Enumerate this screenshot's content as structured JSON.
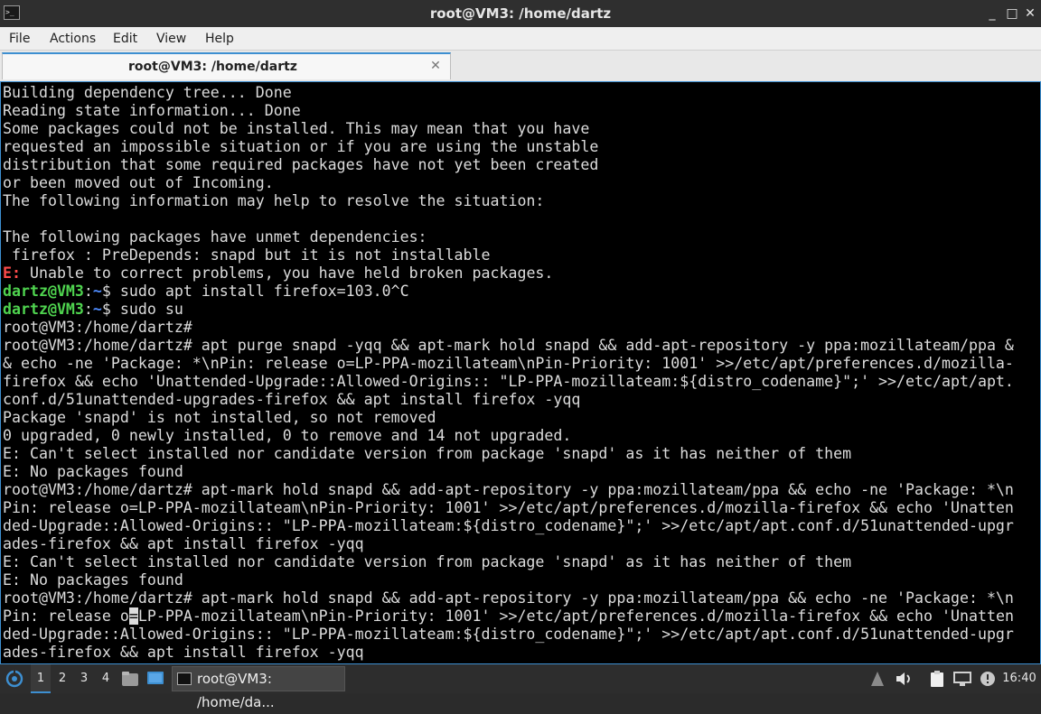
{
  "window": {
    "title": "root@VM3: /home/dartz",
    "icons": {
      "app": "terminal-icon",
      "minimize": "minimize-icon",
      "maximize": "maximize-icon",
      "close": "close-icon"
    },
    "glyphs": {
      "app": ">_",
      "minimize": "_",
      "maximize": "□",
      "close": "✕"
    }
  },
  "menu": {
    "file": "File",
    "actions": "Actions",
    "edit": "Edit",
    "view": "View",
    "help": "Help"
  },
  "tab": {
    "label": "root@VM3: /home/dartz",
    "close_glyph": "✕"
  },
  "terminal": {
    "lines": [
      [
        {
          "t": "Building dependency tree... Done"
        }
      ],
      [
        {
          "t": "Reading state information... Done"
        }
      ],
      [
        {
          "t": "Some packages could not be installed. This may mean that you have"
        }
      ],
      [
        {
          "t": "requested an impossible situation or if you are using the unstable"
        }
      ],
      [
        {
          "t": "distribution that some required packages have not yet been created"
        }
      ],
      [
        {
          "t": "or been moved out of Incoming."
        }
      ],
      [
        {
          "t": "The following information may help to resolve the situation:"
        }
      ],
      [
        {
          "t": ""
        }
      ],
      [
        {
          "t": "The following packages have unmet dependencies:"
        }
      ],
      [
        {
          "t": " firefox : PreDepends: snapd but it is not installable"
        }
      ],
      [
        {
          "t": "E:",
          "c": "red"
        },
        {
          "t": " Unable to correct problems, you have held broken packages."
        }
      ],
      [
        {
          "t": "dartz@VM3",
          "c": "green"
        },
        {
          "t": ":"
        },
        {
          "t": "~",
          "c": "blue"
        },
        {
          "t": "$ sudo apt install firefox=103.0^C"
        }
      ],
      [
        {
          "t": "dartz@VM3",
          "c": "green"
        },
        {
          "t": ":"
        },
        {
          "t": "~",
          "c": "blue"
        },
        {
          "t": "$ sudo su"
        }
      ],
      [
        {
          "t": "root@VM3:/home/dartz#"
        }
      ],
      [
        {
          "t": "root@VM3:/home/dartz# apt purge snapd -yqq && apt-mark hold snapd && add-apt-repository -y ppa:mozillateam/ppa &"
        }
      ],
      [
        {
          "t": "& echo -ne 'Package: *\\nPin: release o=LP-PPA-mozillateam\\nPin-Priority: 1001' >>/etc/apt/preferences.d/mozilla-"
        }
      ],
      [
        {
          "t": "firefox && echo 'Unattended-Upgrade::Allowed-Origins:: \"LP-PPA-mozillateam:${distro_codename}\";' >>/etc/apt/apt."
        }
      ],
      [
        {
          "t": "conf.d/51unattended-upgrades-firefox && apt install firefox -yqq"
        }
      ],
      [
        {
          "t": "Package 'snapd' is not installed, so not removed"
        }
      ],
      [
        {
          "t": "0 upgraded, 0 newly installed, 0 to remove and 14 not upgraded."
        }
      ],
      [
        {
          "t": "E: Can't select installed nor candidate version from package 'snapd' as it has neither of them"
        }
      ],
      [
        {
          "t": "E: No packages found"
        }
      ],
      [
        {
          "t": "root@VM3:/home/dartz# apt-mark hold snapd && add-apt-repository -y ppa:mozillateam/ppa && echo -ne 'Package: *\\n"
        }
      ],
      [
        {
          "t": "Pin: release o=LP-PPA-mozillateam\\nPin-Priority: 1001' >>/etc/apt/preferences.d/mozilla-firefox && echo 'Unatten"
        }
      ],
      [
        {
          "t": "ded-Upgrade::Allowed-Origins:: \"LP-PPA-mozillateam:${distro_codename}\";' >>/etc/apt/apt.conf.d/51unattended-upgr"
        }
      ],
      [
        {
          "t": "ades-firefox && apt install firefox -yqq"
        }
      ],
      [
        {
          "t": "E: Can't select installed nor candidate version from package 'snapd' as it has neither of them"
        }
      ],
      [
        {
          "t": "E: No packages found"
        }
      ],
      [
        {
          "t": "root@VM3:/home/dartz# apt-mark hold snapd && add-apt-repository -y ppa:mozillateam/ppa && echo -ne 'Package: *\\n"
        }
      ],
      [
        {
          "t": "Pin: release o"
        },
        {
          "t": "=",
          "c": "cursor"
        },
        {
          "t": "LP-PPA-mozillateam\\nPin-Priority: 1001' >>/etc/apt/preferences.d/mozilla-firefox && echo 'Unatten"
        }
      ],
      [
        {
          "t": "ded-Upgrade::Allowed-Origins:: \"LP-PPA-mozillateam:${distro_codename}\";' >>/etc/apt/apt.conf.d/51unattended-upgr"
        }
      ],
      [
        {
          "t": "ades-firefox && apt install firefox -yqq"
        }
      ]
    ]
  },
  "taskbar": {
    "start_icon": "start-menu-icon",
    "workspaces": [
      "1",
      "2",
      "3",
      "4"
    ],
    "active_workspace": "1",
    "launchers": [
      "file-manager-icon",
      "desktop-icon"
    ],
    "task_label": "root@VM3: /home/da...",
    "tray_icons": [
      "network-icon",
      "volume-icon",
      "clipboard-icon",
      "display-icon",
      "update-icon"
    ],
    "clock": "16:40"
  }
}
